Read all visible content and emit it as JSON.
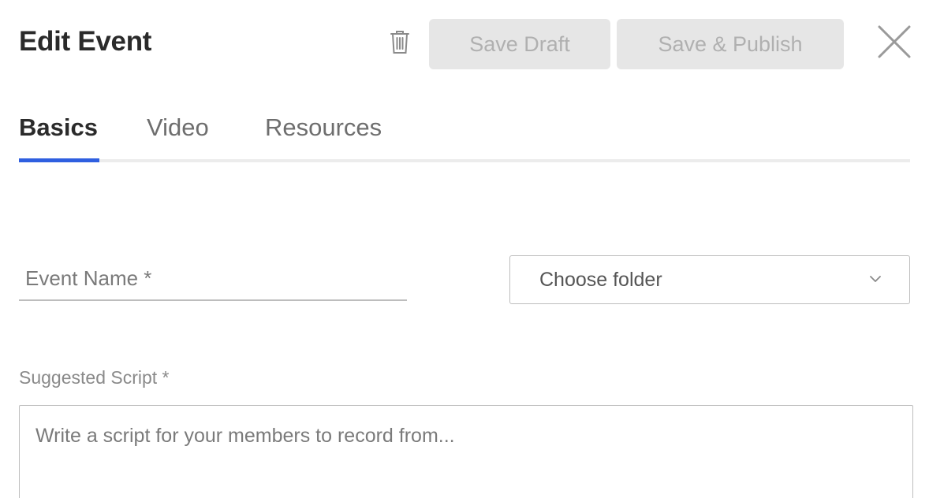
{
  "header": {
    "title": "Edit Event",
    "delete_icon": "trash-icon",
    "save_draft_label": "Save Draft",
    "save_publish_label": "Save & Publish",
    "close_icon": "close-icon"
  },
  "tabs": [
    {
      "label": "Basics",
      "active": true
    },
    {
      "label": "Video",
      "active": false
    },
    {
      "label": "Resources",
      "active": false
    }
  ],
  "form": {
    "event_name": {
      "placeholder": "Event Name *",
      "value": ""
    },
    "folder": {
      "selected": "Choose folder",
      "icon": "chevron-down-icon"
    },
    "script": {
      "label": "Suggested Script *",
      "placeholder": "Write a script for your members to record from...",
      "value": ""
    }
  },
  "colors": {
    "accent": "#2f5fe0",
    "disabled_button_bg": "#e6e6e6",
    "disabled_button_text": "#b0b0b0"
  }
}
